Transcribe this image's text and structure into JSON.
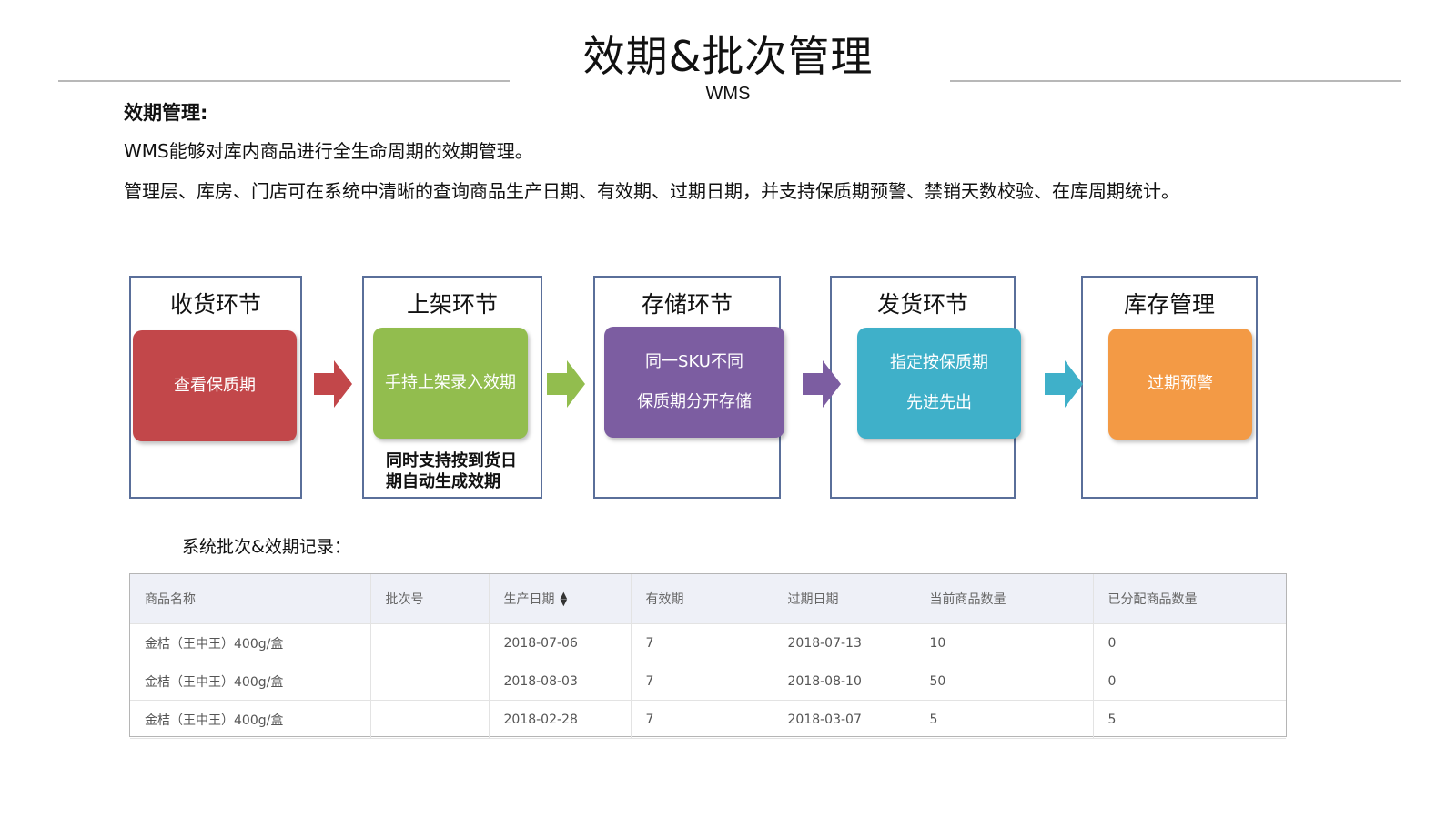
{
  "header": {
    "title": "效期&批次管理",
    "subtitle": "WMS"
  },
  "intro": {
    "heading": "效期管理:",
    "line1": "WMS能够对库内商品进行全生命周期的效期管理。",
    "line2": "管理层、库房、门店可在系统中清晰的查询商品生产日期、有效期、过期日期，并支持保质期预警、禁销天数校验、在库周期统计。"
  },
  "flow": {
    "stages": [
      {
        "title": "收货环节",
        "lines": [
          "查看保质期"
        ],
        "color": "#c2474a"
      },
      {
        "title": "上架环节",
        "lines": [
          "手持上架录入效期"
        ],
        "color": "#92bd4e",
        "note_lines": [
          "同时支持按到货日",
          "期自动生成效期"
        ]
      },
      {
        "title": "存储环节",
        "lines": [
          "同一SKU不同",
          "保质期分开存储"
        ],
        "color": "#7c5da1"
      },
      {
        "title": "发货环节",
        "lines": [
          "指定按保质期",
          "先进先出"
        ],
        "color": "#3fb0c9"
      },
      {
        "title": "库存管理",
        "lines": [
          "过期预警"
        ],
        "color": "#f39a45"
      }
    ],
    "arrow_colors": [
      "#c2474a",
      "#92bd4e",
      "#7c5da1",
      "#3fb0c9"
    ]
  },
  "records": {
    "label": "系统批次&效期记录：",
    "columns": [
      "商品名称",
      "批次号",
      "生产日期",
      "有效期",
      "过期日期",
      "当前商品数量",
      "已分配商品数量"
    ],
    "sortable_column_index": 2,
    "rows": [
      [
        "金桔（王中王）400g/盒",
        "",
        "2018-07-06",
        "7",
        "2018-07-13",
        "10",
        "0"
      ],
      [
        "金桔（王中王）400g/盒",
        "",
        "2018-08-03",
        "7",
        "2018-08-10",
        "50",
        "0"
      ],
      [
        "金桔（王中王）400g/盒",
        "",
        "2018-02-28",
        "7",
        "2018-03-07",
        "5",
        "5"
      ]
    ]
  }
}
